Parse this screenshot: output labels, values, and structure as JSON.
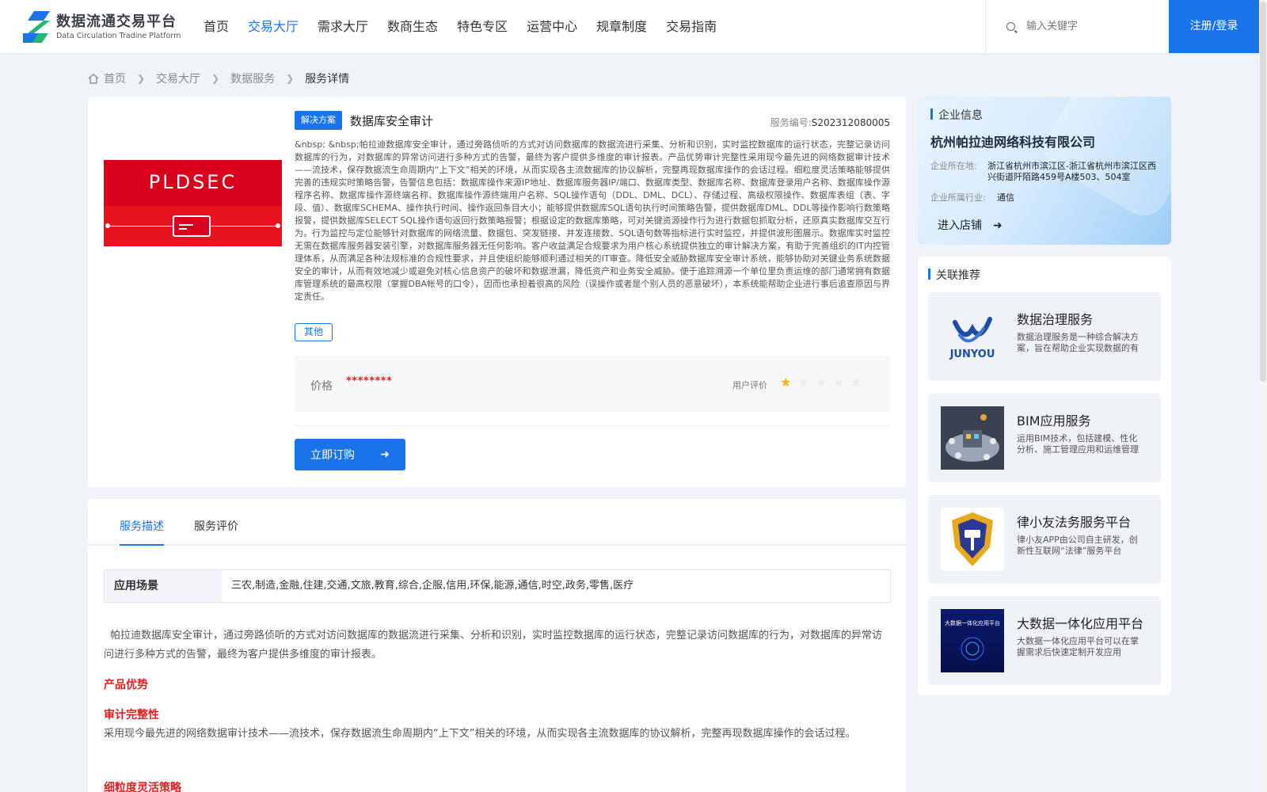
{
  "header": {
    "logo_cn": "数据流通交易平台",
    "logo_en": "Data Circulation Tradine Platform",
    "nav": [
      {
        "label": "首页",
        "active": false
      },
      {
        "label": "交易大厅",
        "active": true
      },
      {
        "label": "需求大厅",
        "active": false
      },
      {
        "label": "数商生态",
        "active": false
      },
      {
        "label": "特色专区",
        "active": false
      },
      {
        "label": "运营中心",
        "active": false
      },
      {
        "label": "规章制度",
        "active": false
      },
      {
        "label": "交易指南",
        "active": false
      }
    ],
    "search_placeholder": "输入关键字",
    "register_label": "注册/登录",
    "accent_color": "#1a73e8"
  },
  "breadcrumb": {
    "home": "首页",
    "items": [
      "交易大厅",
      "数据服务"
    ],
    "current": "服务详情"
  },
  "service": {
    "image_text": "PLDSEC",
    "tag": "解决方案",
    "title": "数据库安全审计",
    "number_label": "服务编号:",
    "number": "S202312080005",
    "description": "&nbsp; &nbsp;帕拉迪数据库安全审计，通过旁路侦听的方式对访问数据库的数据流进行采集、分析和识别，实时监控数据库的运行状态，完整记录访问数据库的行为，对数据库的异常访问进行多种方式的告警，最终为客户提供多维度的审计报表。产品优势审计完整性采用现今最先进的网络数据审计技术——流技术，保存数据流生命周期内“上下文”相关的环境，从而实现各主流数据库的协议解析，完整再现数据库操作的会话过程。细粒度灵活策略能够提供完善的违规实时策略告警，告警信息包括：数据库操作来源IP地址、数据库服务器IP/端口、数据库类型、数据库名称、数据库登录用户名称、数据库操作源程序名称、数据库操作源终端名称、数据库操作源终端用户名称、SQL操作语句（DDL、DML、DCL）、存储过程、高级权限操作、数据库表组（表、字段、值）、数据库SCHEMA、操作执行时间、操作返回条目大小；能够提供数据库SQL语句执行时间策略告警，提供数据库DML、DDL等操作影响行数策略报警，提供数据库SELECT SQL操作语句返回行数策略报警；根据设定的数据库策略，可对关键资源操作行为进行数据包抓取分析，还原真实数据库交互行为。行为监控与定位能够针对数据库的网络流量、数据包、突发链接、并发连接数、SQL语句数等指标进行实时监控，并提供波形图展示。数据库实时监控无需在数据库服务器安装引擎，对数据库服务器无任何影响。客户收益满足合规要求为用户核心系统提供独立的审计解决方案，有助于完善组织的IT内控管理体系，从而满足各种法规标准的合规性要求，并且使组织能够顺利通过相关的IT审查。降低安全威胁数据库安全审计系统，能够协助对关键业务系统数据安全的审计，从而有效地减少或避免对核心信息资产的破坏和数据泄漏，降低资产和业务安全威胁。便于追踪溯源一个单位里负责运维的部门通常拥有数据库管理系统的最高权限（掌握DBA帐号的口令），因而也承担着很高的风险（误操作或者是个别人员的恶意破坏），本系统能帮助企业进行事后追查原因与界定责任。",
    "category_tag": "其他",
    "price_label": "价格",
    "price_value": "********",
    "rating_label": "用户评价",
    "rating": 1,
    "rating_max": 5,
    "buy_label": "立即订购"
  },
  "tabs": [
    {
      "label": "服务描述",
      "active": true
    },
    {
      "label": "服务评价",
      "active": false
    }
  ],
  "detail": {
    "scene_label": "应用场景",
    "scene_value": "三农,制造,金融,住建,交通,文旅,教育,综合,企服,信用,环保,能源,通信,时空,政务,零售,医疗",
    "intro": "帕拉迪数据库安全审计，通过旁路侦听的方式对访问数据库的数据流进行采集、分析和识别，实时监控数据库的运行状态，完整记录访问数据库的行为，对数据库的异常访问进行多种方式的告警，最终为客户提供多维度的审计报表。",
    "h_advantage": "产品优势",
    "h_completeness": "审计完整性",
    "completeness_text": "采用现今最先进的网络数据审计技术——流技术，保存数据流生命周期内“上下文”相关的环境，从而实现各主流数据库的协议解析，完整再现数据库操作的会话过程。",
    "h_strategy": "细粒度灵活策略"
  },
  "company": {
    "section_title": "企业信息",
    "name": "杭州帕拉迪网络科技有限公司",
    "location_label": "企业所在地:",
    "location": "浙江省杭州市滨江区-浙江省杭州市滨江区西兴街道阡陌路459号A楼503、504室",
    "industry_label": "企业所属行业:",
    "industry": "通信",
    "store_label": "进入店铺"
  },
  "related": {
    "section_title": "关联推荐",
    "items": [
      {
        "title": "数据治理服务",
        "desc": "数据治理服务是一种综合解决方案，旨在帮助企业实现数据的有效管理",
        "thumb": "junyou-logo",
        "thumb_text": "JUNYOU"
      },
      {
        "title": "BIM应用服务",
        "desc": "运用BIM技术，包括建模、性化分析、施工管理应用和运维管理",
        "thumb": "bim-illustration"
      },
      {
        "title": "律小友法务服务平台",
        "desc": "律小友APP由公司自主研发，创新性互联网“法律”服务平台",
        "thumb": "shield-gavel-logo"
      },
      {
        "title": "大数据一体化应用平台",
        "desc": "大数据一体化应用平台可以在掌握需求后快速定制开发应用",
        "thumb": "bigdata-cover",
        "thumb_text": "大数据一体化应用平台"
      }
    ]
  }
}
